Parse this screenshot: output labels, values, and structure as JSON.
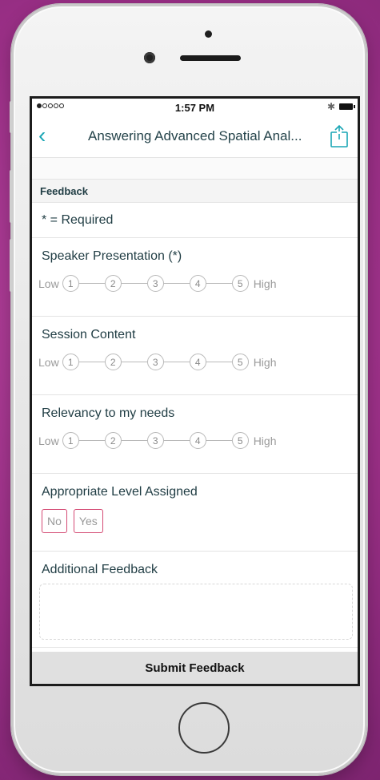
{
  "status_bar": {
    "time": "1:57 PM",
    "bluetooth_icon": "bluetooth-icon",
    "battery_icon": "battery-icon"
  },
  "nav": {
    "title": "Answering Advanced Spatial Anal...",
    "back_icon": "chevron-left-icon",
    "share_icon": "share-icon",
    "accent": "#1aa6b5"
  },
  "form": {
    "section_title": "Feedback",
    "required_note": "* = Required",
    "ratings": [
      {
        "question": "Speaker Presentation (*)",
        "low": "Low",
        "high": "High",
        "options": [
          "1",
          "2",
          "3",
          "4",
          "5"
        ]
      },
      {
        "question": "Session Content",
        "low": "Low",
        "high": "High",
        "options": [
          "1",
          "2",
          "3",
          "4",
          "5"
        ]
      },
      {
        "question": "Relevancy to my needs",
        "low": "Low",
        "high": "High",
        "options": [
          "1",
          "2",
          "3",
          "4",
          "5"
        ]
      }
    ],
    "level": {
      "question": "Appropriate Level Assigned",
      "no": "No",
      "yes": "Yes",
      "accent": "#d44a73"
    },
    "additional": {
      "label": "Additional Feedback",
      "value": ""
    },
    "submit_label": "Submit Feedback"
  }
}
